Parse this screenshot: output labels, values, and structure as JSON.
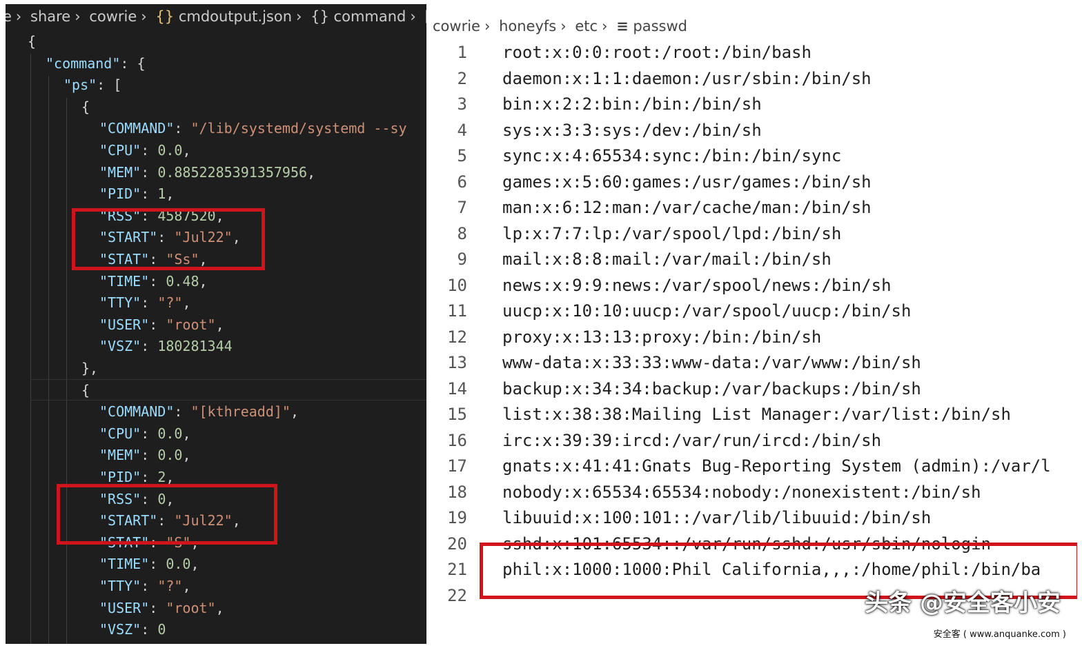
{
  "left_panel": {
    "breadcrumb": [
      "e",
      "share",
      "cowrie",
      "{}",
      "cmdoutput.json",
      "{}",
      "command",
      "[ ]"
    ],
    "lines": [
      [
        [
          "p",
          "{"
        ]
      ],
      [
        [
          "k",
          "\"command\""
        ],
        [
          "p",
          ": {"
        ]
      ],
      [
        [
          "k",
          "\"ps\""
        ],
        [
          "p",
          ": ["
        ]
      ],
      [
        [
          "p",
          "{"
        ]
      ],
      [
        [
          "k",
          "\"COMMAND\""
        ],
        [
          "p",
          ": "
        ],
        [
          "s",
          "\"/lib/systemd/systemd --sy"
        ]
      ],
      [
        [
          "k",
          "\"CPU\""
        ],
        [
          "p",
          ": "
        ],
        [
          "n",
          "0.0"
        ],
        [
          "p",
          ","
        ]
      ],
      [
        [
          "k",
          "\"MEM\""
        ],
        [
          "p",
          ": "
        ],
        [
          "n",
          "0.8852285391357956"
        ],
        [
          "p",
          ","
        ]
      ],
      [
        [
          "k",
          "\"PID\""
        ],
        [
          "p",
          ": "
        ],
        [
          "n",
          "1"
        ],
        [
          "p",
          ","
        ]
      ],
      [
        [
          "k",
          "\"RSS\""
        ],
        [
          "p",
          ": "
        ],
        [
          "n",
          "4587520"
        ],
        [
          "p",
          ","
        ]
      ],
      [
        [
          "k",
          "\"START\""
        ],
        [
          "p",
          ": "
        ],
        [
          "s",
          "\"Jul22\""
        ],
        [
          "p",
          ","
        ]
      ],
      [
        [
          "k",
          "\"STAT\""
        ],
        [
          "p",
          ": "
        ],
        [
          "s",
          "\"Ss\""
        ],
        [
          "p",
          ","
        ]
      ],
      [
        [
          "k",
          "\"TIME\""
        ],
        [
          "p",
          ": "
        ],
        [
          "n",
          "0.48"
        ],
        [
          "p",
          ","
        ]
      ],
      [
        [
          "k",
          "\"TTY\""
        ],
        [
          "p",
          ": "
        ],
        [
          "s",
          "\"?\""
        ],
        [
          "p",
          ","
        ]
      ],
      [
        [
          "k",
          "\"USER\""
        ],
        [
          "p",
          ": "
        ],
        [
          "s",
          "\"root\""
        ],
        [
          "p",
          ","
        ]
      ],
      [
        [
          "k",
          "\"VSZ\""
        ],
        [
          "p",
          ": "
        ],
        [
          "n",
          "180281344"
        ]
      ],
      [
        [
          "p",
          "},"
        ]
      ],
      [
        [
          "p",
          "{"
        ]
      ],
      [
        [
          "k",
          "\"COMMAND\""
        ],
        [
          "p",
          ": "
        ],
        [
          "s",
          "\"[kthreadd]\""
        ],
        [
          "p",
          ","
        ]
      ],
      [
        [
          "k",
          "\"CPU\""
        ],
        [
          "p",
          ": "
        ],
        [
          "n",
          "0.0"
        ],
        [
          "p",
          ","
        ]
      ],
      [
        [
          "k",
          "\"MEM\""
        ],
        [
          "p",
          ": "
        ],
        [
          "n",
          "0.0"
        ],
        [
          "p",
          ","
        ]
      ],
      [
        [
          "k",
          "\"PID\""
        ],
        [
          "p",
          ": "
        ],
        [
          "n",
          "2"
        ],
        [
          "p",
          ","
        ]
      ],
      [
        [
          "k",
          "\"RSS\""
        ],
        [
          "p",
          ": "
        ],
        [
          "n",
          "0"
        ],
        [
          "p",
          ","
        ]
      ],
      [
        [
          "k",
          "\"START\""
        ],
        [
          "p",
          ": "
        ],
        [
          "s",
          "\"Jul22\""
        ],
        [
          "p",
          ","
        ]
      ],
      [
        [
          "k",
          "\"STAT\""
        ],
        [
          "p",
          ": "
        ],
        [
          "s",
          "\"S\""
        ],
        [
          "p",
          ","
        ]
      ],
      [
        [
          "k",
          "\"TIME\""
        ],
        [
          "p",
          ": "
        ],
        [
          "n",
          "0.0"
        ],
        [
          "p",
          ","
        ]
      ],
      [
        [
          "k",
          "\"TTY\""
        ],
        [
          "p",
          ": "
        ],
        [
          "s",
          "\"?\""
        ],
        [
          "p",
          ","
        ]
      ],
      [
        [
          "k",
          "\"USER\""
        ],
        [
          "p",
          ": "
        ],
        [
          "s",
          "\"root\""
        ],
        [
          "p",
          ","
        ]
      ],
      [
        [
          "k",
          "\"VSZ\""
        ],
        [
          "p",
          ": "
        ],
        [
          "n",
          "0"
        ]
      ]
    ]
  },
  "right_panel": {
    "breadcrumb": [
      "cowrie",
      "honeyfs",
      "etc",
      "passwd"
    ],
    "lines": [
      "root:x:0:0:root:/root:/bin/bash",
      "daemon:x:1:1:daemon:/usr/sbin:/bin/sh",
      "bin:x:2:2:bin:/bin:/bin/sh",
      "sys:x:3:3:sys:/dev:/bin/sh",
      "sync:x:4:65534:sync:/bin:/bin/sync",
      "games:x:5:60:games:/usr/games:/bin/sh",
      "man:x:6:12:man:/var/cache/man:/bin/sh",
      "lp:x:7:7:lp:/var/spool/lpd:/bin/sh",
      "mail:x:8:8:mail:/var/mail:/bin/sh",
      "news:x:9:9:news:/var/spool/news:/bin/sh",
      "uucp:x:10:10:uucp:/var/spool/uucp:/bin/sh",
      "proxy:x:13:13:proxy:/bin:/bin/sh",
      "www-data:x:33:33:www-data:/var/www:/bin/sh",
      "backup:x:34:34:backup:/var/backups:/bin/sh",
      "list:x:38:38:Mailing List Manager:/var/list:/bin/sh",
      "irc:x:39:39:ircd:/var/run/ircd:/bin/sh",
      "gnats:x:41:41:Gnats Bug-Reporting System (admin):/var/l",
      "nobody:x:65534:65534:nobody:/nonexistent:/bin/sh",
      "libuuid:x:100:101::/var/lib/libuuid:/bin/sh",
      "sshd:x:101:65534::/var/run/sshd:/usr/sbin/nologin",
      "phil:x:1000:1000:Phil California,,,:/home/phil:/bin/ba",
      ""
    ]
  },
  "watermark": {
    "main": "头条 @安全客小安",
    "sub": "安全客 ( www.anquanke.com )"
  },
  "colors": {
    "highlight_box": "#d0141c",
    "editor_bg": "#1e1e1e",
    "json_key": "#9cdcfe",
    "json_string": "#ce9178",
    "json_number": "#b5cea8"
  }
}
